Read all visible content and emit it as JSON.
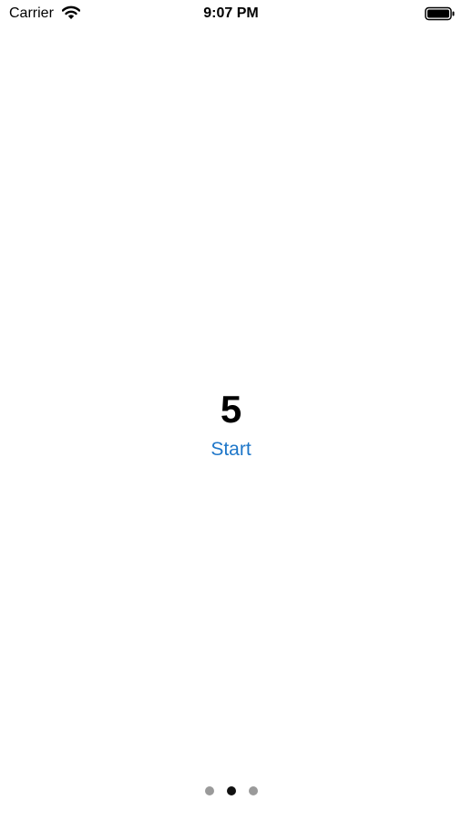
{
  "status_bar": {
    "carrier": "Carrier",
    "time": "9:07 PM",
    "wifi_icon": "wifi-icon",
    "battery_icon": "battery-icon"
  },
  "main": {
    "counter_value": "5",
    "start_label": "Start",
    "accent_color": "#1f77c9"
  },
  "page_control": {
    "page_count": 3,
    "current_page": 2
  }
}
